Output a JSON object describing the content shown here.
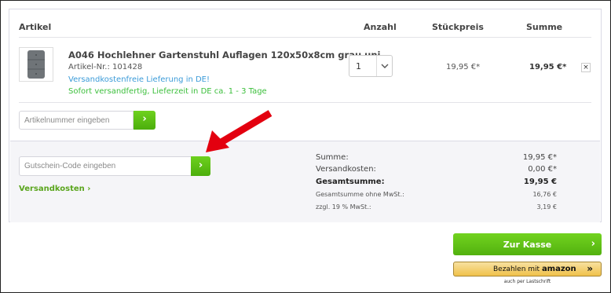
{
  "table_header": {
    "artikel": "Artikel",
    "anzahl": "Anzahl",
    "stueckpreis": "Stückpreis",
    "summe": "Summe"
  },
  "product": {
    "title": "A046 Hochlehner Gartenstuhl Auflagen 120x50x8cm grau uni",
    "article_no": "Artikel-Nr.: 101428",
    "shipping_free": "Versandkostenfreie Lieferung in DE!",
    "delivery": "Sofort versandfertig, Lieferzeit in DE ca. 1 - 3 Tage",
    "quantity": "1",
    "unit_price": "19,95 €*",
    "total": "19,95 €*",
    "remove": "×"
  },
  "add_article": {
    "placeholder": "Artikelnummer eingeben",
    "button": "›"
  },
  "voucher": {
    "placeholder": "Gutschein-Code eingeben",
    "button": "›"
  },
  "shipping_link": "Versandkosten ›",
  "summary": {
    "summe_label": "Summe:",
    "summe_value": "19,95 €*",
    "versand_label": "Versandkosten:",
    "versand_value": "0,00 €*",
    "gesamt_label": "Gesamtsumme:",
    "gesamt_value": "19,95 €",
    "netto_label": "Gesamtsumme ohne MwSt.:",
    "netto_value": "16,76 €",
    "mwst_label": "zzgl. 19 % MwSt.:",
    "mwst_value": "3,19 €"
  },
  "checkout": {
    "label": "Zur Kasse",
    "arrow": "›"
  },
  "amazon_pay": {
    "prefix": "Bezahlen mit",
    "brand": "amazon",
    "arrows": "»",
    "note": "auch per Lastschrift"
  },
  "colors": {
    "accent_green": "#5cbd12",
    "arrow_red": "#e3000f",
    "link_blue": "#3b9bd8"
  }
}
